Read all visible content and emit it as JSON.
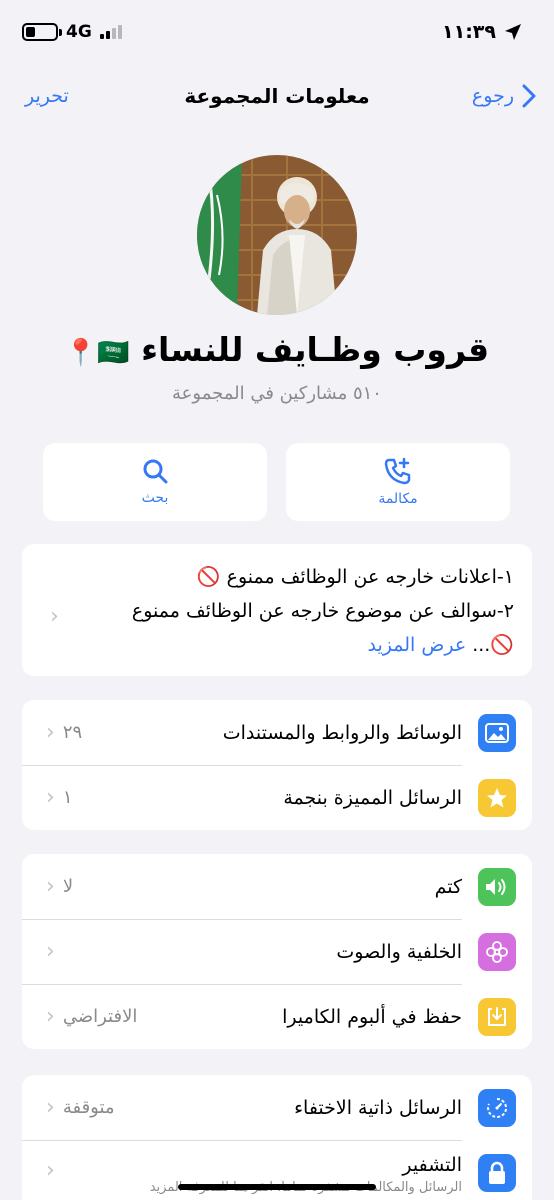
{
  "status_bar": {
    "network": "4G",
    "time": "١١:٣٩"
  },
  "nav": {
    "edit_label": "تحرير",
    "title": "معلومات المجموعة",
    "back_label": "رجوع"
  },
  "group": {
    "name": "قروب وظـايف للنساء",
    "name_emojis": "🇸🇦📍",
    "members": "٥١٠ مشاركين في المجموعة"
  },
  "actions": {
    "search_label": "بحث",
    "call_label": "مكالمة"
  },
  "description": {
    "line1": "١-اعلانات خارجه عن الوظائف ممنوع 🚫",
    "line2": "٢-سوالف عن موضوع خارجه عن الوظائف ممنوع",
    "line3_prefix": "🚫...",
    "more_label": "عرض المزيد"
  },
  "section1": {
    "media_label": "الوسائط والروابط والمستندات",
    "media_count": "٢٩",
    "starred_label": "الرسائل المميزة بنجمة",
    "starred_count": "١"
  },
  "section2": {
    "mute_label": "كتم",
    "mute_value": "لا",
    "wallpaper_label": "الخلفية والصوت",
    "save_label": "حفظ في ألبوم الكاميرا",
    "save_value": "الافتراضي"
  },
  "section3": {
    "disappearing_label": "الرسائل ذاتية الاختفاء",
    "disappearing_value": "متوقفة",
    "encryption_label": "التشفير",
    "encryption_sub": "الرسائل والمكالمات مشفرة تماماً. انقر هنا للمعرفة المزيد"
  },
  "colors": {
    "accent": "#3478f6",
    "media_icon": "#2f7ff5",
    "star_icon": "#f7c833",
    "mute_icon": "#4cc45a",
    "wallpaper_icon": "#d56fe0",
    "save_icon": "#f7c833",
    "disappearing_icon": "#2f7ff5",
    "encryption_icon": "#2f7ff5"
  }
}
